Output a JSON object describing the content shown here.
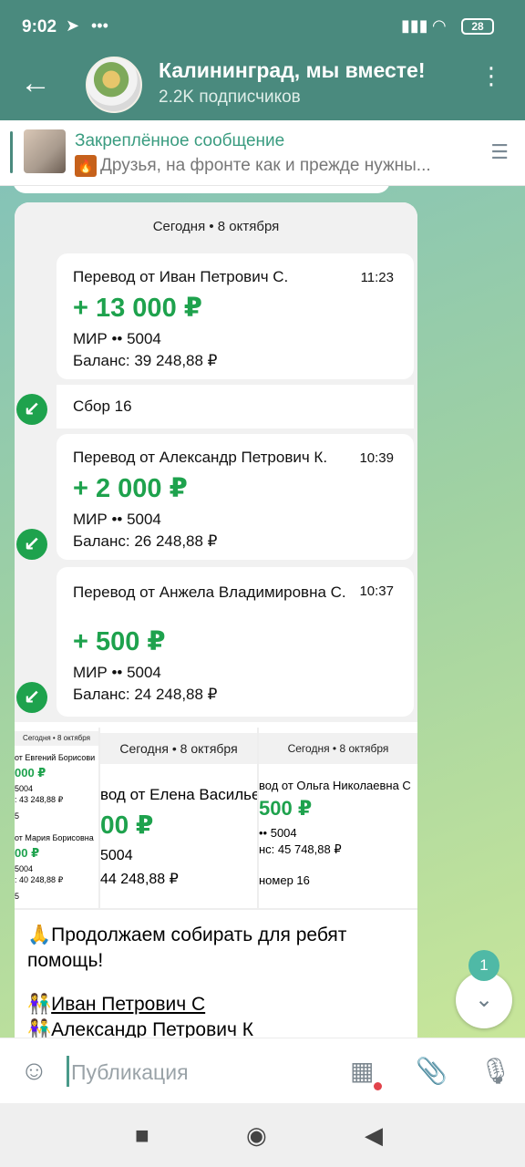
{
  "status": {
    "time": "9:02",
    "battery": "28"
  },
  "header": {
    "title": "Калининград, мы вместе!",
    "subscribers": "2.2K подписчиков"
  },
  "pinned": {
    "title": "Закреплённое сообщение",
    "text": "Друзья, на фронте как и прежде нужны..."
  },
  "receipt": {
    "date": "Сегодня • 8 октября",
    "transfers": [
      {
        "name": "Перевод от Иван Петрович С.",
        "time": "11:23",
        "amount": "+ 13 000 ₽",
        "card": "МИР •• 5004",
        "balance": "Баланс: 39 248,88 ₽"
      },
      {
        "name": "Перевод от Александр Петрович К.",
        "time": "10:39",
        "amount": "+ 2 000 ₽",
        "card": "МИР •• 5004",
        "balance": "Баланс: 26 248,88 ₽"
      },
      {
        "name": "Перевод от Анжела Владимировна С.",
        "time": "10:37",
        "amount": "+ 500 ₽",
        "card": "МИР •• 5004",
        "balance": "Баланс: 24 248,88 ₽"
      }
    ],
    "note": "Сбор 16"
  },
  "collage": {
    "left": {
      "date": "Сегодня • 8 октября",
      "t1": "от Евгений Борисови",
      "a1": "000 ₽",
      "c1": "5004",
      "b1": ": 43 248,88 ₽",
      "n1": "5",
      "t2": "от Мария Борисовна",
      "a2": "00 ₽",
      "c2": "5004",
      "b2": ": 40 248,88 ₽",
      "n2": "5"
    },
    "middle": {
      "date": "Сегодня • 8 октября",
      "name": "вод от Елена Васильевна",
      "amount": "00 ₽",
      "card": "5004",
      "balance": "44 248,88 ₽"
    },
    "right": {
      "date": "Сегодня • 8 октября",
      "name": "вод от Ольга Николаевна С",
      "amount": "500 ₽",
      "card": "•• 5004",
      "balance": "нс: 45 748,88 ₽",
      "note": "номер 16"
    }
  },
  "post": {
    "line1": "🙏Продолжаем собирать для ребят помощь!",
    "donor1": "Иван Петрович С",
    "donor2": "Александр Петрович К"
  },
  "scroll": {
    "unread": "1"
  },
  "input": {
    "placeholder": "Публикация"
  }
}
